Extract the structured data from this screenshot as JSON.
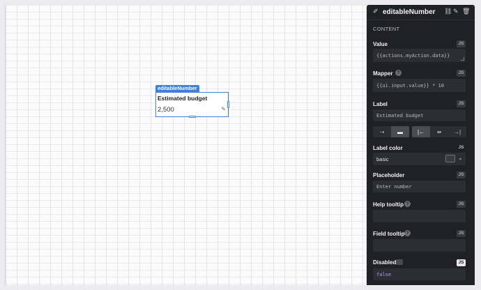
{
  "component": {
    "tag": "editableNumber",
    "label": "Estimated budget",
    "value": "2,500",
    "edit_icon": "pencil-icon"
  },
  "panel": {
    "title": "editableNumber",
    "section": "CONTENT",
    "js": "JS",
    "fields": {
      "value": {
        "label": "Value",
        "code": "{{actions.myAction.data}}"
      },
      "mapper": {
        "label": "Mapper",
        "help": "?",
        "code": "{{ui.input.value}} * 10"
      },
      "label": {
        "label": "Label",
        "text": "Estimated budget"
      },
      "label_color": {
        "label": "Label color",
        "value": "basic"
      },
      "placeholder": {
        "label": "Placeholder",
        "text": "Enter number"
      },
      "help_tooltip": {
        "label": "Help tooltip",
        "help": "?"
      },
      "field_tooltip": {
        "label": "Field tooltip",
        "help": "?"
      },
      "disabled": {
        "label": "Disabled",
        "value": "false"
      }
    },
    "icons": {
      "header": "edit-sparkle-icon",
      "unlink": "unlink-icon",
      "brush": "brush-icon",
      "trash": "trash-icon"
    }
  },
  "colors": {
    "accent": "#3d82d6",
    "panel_bg": "#202126"
  }
}
